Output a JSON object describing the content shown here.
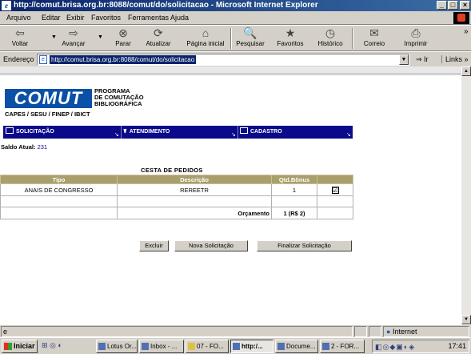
{
  "window": {
    "title": "http://comut.brisa.org.br:8088/comut/do/solicitacao - Microsoft Internet Explorer",
    "buttons": {
      "minimize": "_",
      "maximize": "□",
      "close": "×"
    }
  },
  "menu": [
    "Arquivo",
    "Editar",
    "Exibir",
    "Favoritos",
    "Ferramentas",
    "Ajuda"
  ],
  "toolbar": {
    "back": {
      "label": "Voltar",
      "icon": "⇦"
    },
    "forward": {
      "label": "Avançar",
      "icon": "⇨"
    },
    "stop": {
      "label": "Parar",
      "icon": "⊗"
    },
    "refresh": {
      "label": "Atualizar",
      "icon": "⟳"
    },
    "home": {
      "label": "Página inicial",
      "icon": "⌂"
    },
    "search": {
      "label": "Pesquisar",
      "icon": "🔍"
    },
    "favorites": {
      "label": "Favoritos",
      "icon": "★"
    },
    "history": {
      "label": "Histórico",
      "icon": "◷"
    },
    "mail": {
      "label": "Correio",
      "icon": "✉"
    },
    "print": {
      "label": "Imprimir",
      "icon": "⎙"
    },
    "overflow": "»"
  },
  "address": {
    "label": "Endereço",
    "url": "http://comut.brisa.org.br:8088/comut/do/solicitacao",
    "go": "Ir",
    "links": "Links"
  },
  "page": {
    "logo": {
      "word": "COMUT",
      "lines": [
        "PROGRAMA",
        "DE COMUTAÇÃO",
        "BIBLIOGRÁFICA"
      ],
      "sub": "CAPES / SESU / FINEP / IBICT"
    },
    "nav": {
      "tab1": "SOLICITAÇÃO",
      "tab2": "ATENDIMENTO",
      "tab3": "CADASTRO"
    },
    "saldo": {
      "label": "Saldo Atual:",
      "value": "231"
    },
    "cesta_title": "CESTA DE PEDIDOS",
    "table": {
      "headers": {
        "tipo": "Tipo",
        "descricao": "Descrição",
        "qtd": "Qtd.Bônus"
      },
      "row": {
        "tipo": "ANAIS DE CONGRESSO",
        "descricao": "REREETR",
        "qtd": "1",
        "checked": "☑"
      },
      "orcamento_label": "Orçamento",
      "orcamento_value": "1 (R$ 2)"
    },
    "buttons": {
      "excluir": "Excluir",
      "nova": "Nova Solicitação",
      "finalizar": "Finalizar Solicitação"
    }
  },
  "statusbar": {
    "zone": "Internet"
  },
  "taskbar": {
    "start": "Iniciar",
    "tasks": [
      "Lotus Or...",
      "Inbox - ...",
      "07 - FO...",
      "http:/...",
      "Docume...",
      "2 - FOR..."
    ],
    "clock": "17:41"
  }
}
